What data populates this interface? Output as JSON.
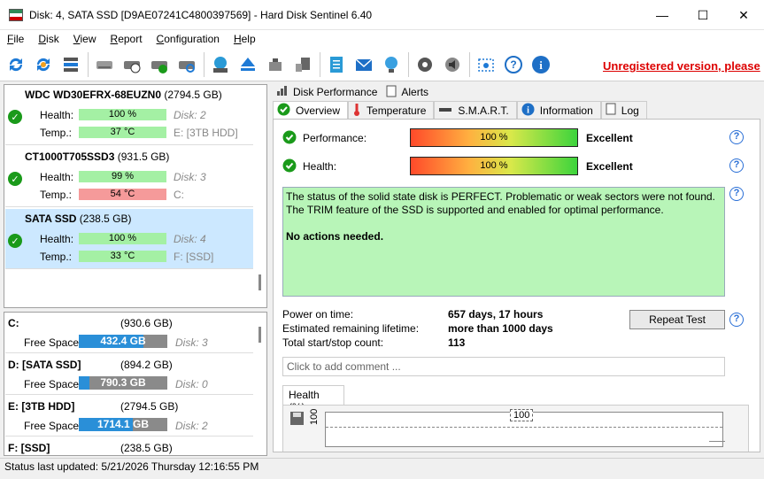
{
  "window": {
    "title": "Disk: 4, SATA SSD [D9AE07241C4800397569]  -  Hard Disk Sentinel 6.40",
    "minimize": "—",
    "maximize": "☐",
    "close": "✕"
  },
  "menu": [
    {
      "underline": "F",
      "rest": "ile"
    },
    {
      "underline": "D",
      "rest": "isk"
    },
    {
      "underline": "V",
      "rest": "iew"
    },
    {
      "underline": "R",
      "rest": "eport"
    },
    {
      "underline": "C",
      "rest": "onfiguration"
    },
    {
      "underline": "H",
      "rest": "elp"
    }
  ],
  "toolbar": {
    "unregistered": "Unregistered version, please"
  },
  "disks": [
    {
      "model": "WDC WD30EFRX-68EUZN0",
      "size": "(2794.5 GB)",
      "health_label": "Health:",
      "health_value": "100 %",
      "health_pct": 100,
      "temp_label": "Temp.:",
      "temp_value": "37 °C",
      "disk_index": "Disk: 2",
      "drive": "E: [3TB HDD]",
      "temp_color": "#a4f0a4"
    },
    {
      "model": "CT1000T705SSD3",
      "size": "(931.5 GB)",
      "health_label": "Health:",
      "health_value": "99 %",
      "health_pct": 99,
      "temp_label": "Temp.:",
      "temp_value": "54 °C",
      "disk_index": "Disk: 3",
      "drive": "C:",
      "temp_color": "#f59a9a"
    },
    {
      "model": "SATA SSD",
      "size": "(238.5 GB)",
      "health_label": "Health:",
      "health_value": "100 %",
      "health_pct": 100,
      "temp_label": "Temp.:",
      "temp_value": "33 °C",
      "disk_index": "Disk: 4",
      "drive": "F: [SSD]",
      "temp_color": "#a4f0a4"
    }
  ],
  "volumes": [
    {
      "name": "C:",
      "size": "(930.6 GB)",
      "free_label": "Free Space",
      "free": "432.4 GB",
      "free_pct": 46,
      "disk": "Disk: 3"
    },
    {
      "name": "D: [SATA SSD]",
      "size": "(894.2 GB)",
      "free_label": "Free Space",
      "free": "790.3 GB",
      "free_pct": 12,
      "disk": "Disk: 0"
    },
    {
      "name": "E: [3TB HDD]",
      "size": "(2794.5 GB)",
      "free_label": "Free Space",
      "free": "1714.1 GB",
      "free_pct": 39,
      "disk": "Disk: 2"
    },
    {
      "name": "F: [SSD]",
      "size": "(238.5 GB)"
    }
  ],
  "tabs_top": [
    "Disk Performance",
    "Alerts"
  ],
  "tabs_sub": [
    "Overview",
    "Temperature",
    "S.M.A.R.T.",
    "Information",
    "Log"
  ],
  "overview": {
    "performance_label": "Performance:",
    "performance_value": "100 %",
    "performance_pct": 100,
    "performance_rating": "Excellent",
    "health_label": "Health:",
    "health_value": "100 %",
    "health_pct": 100,
    "health_rating": "Excellent",
    "status_line1": "The status of the solid state disk is PERFECT. Problematic or weak sectors were not found.",
    "status_line2": "The TRIM feature of the SSD is supported and enabled for optimal performance.",
    "status_line3": "No actions needed.",
    "power_on_label": "Power on time:",
    "power_on_value": "657 days, 17 hours",
    "lifetime_label": "Estimated remaining lifetime:",
    "lifetime_value": "more than 1000 days",
    "startstop_label": "Total start/stop count:",
    "startstop_value": "113",
    "repeat_test": "Repeat Test",
    "comment_placeholder": "Click to add comment ...",
    "health_graph_tab": "Health (%)",
    "graph_value_label": "100",
    "graph_axis_label": "100"
  },
  "statusbar": "Status last updated: 5/21/2026 Thursday 12:16:55 PM"
}
